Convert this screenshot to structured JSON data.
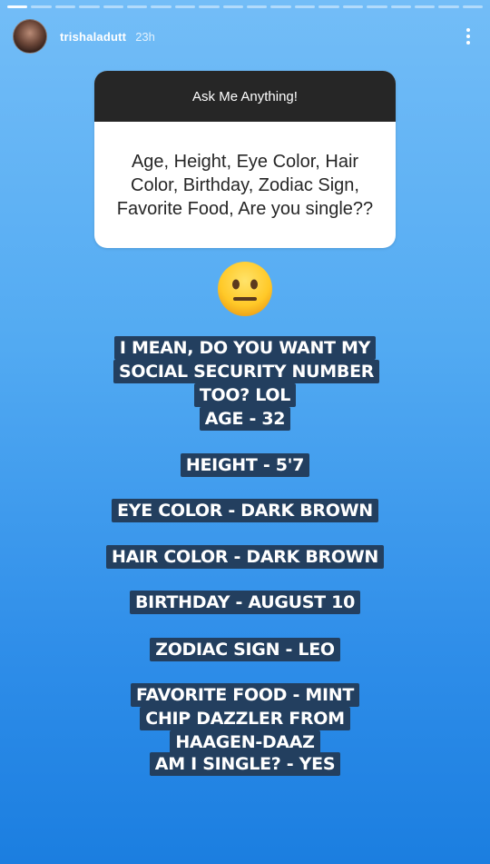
{
  "story": {
    "progress_segments": 20,
    "progress_done": 1
  },
  "header": {
    "username": "trishaladutt",
    "time": "23h",
    "avatar_icon": "profile-photo",
    "menu_icon": "more-vertical-icon"
  },
  "question_card": {
    "title": "Ask Me Anything!",
    "question": "Age, Height, Eye Color, Hair Color, Birthday, Zodiac Sign, Favorite Food, Are you single??"
  },
  "emoji": "neutral-face",
  "answers": [
    "I MEAN, DO YOU WANT MY SOCIAL SECURITY NUMBER TOO? LOL",
    "AGE - 32",
    "HEIGHT - 5'7",
    "EYE COLOR - DARK BROWN",
    "HAIR COLOR - DARK BROWN",
    "BIRTHDAY - AUGUST 10",
    "ZODIAC SIGN - LEO",
    "FAVORITE FOOD - MINT CHIP DAZZLER FROM HAAGEN-DAAZ",
    "AM I SINGLE? - YES"
  ],
  "colors": {
    "label_bg": "#233f5f",
    "card_header": "#262626",
    "background_top": "#73bdf7",
    "background_bottom": "#1b7ee0"
  }
}
